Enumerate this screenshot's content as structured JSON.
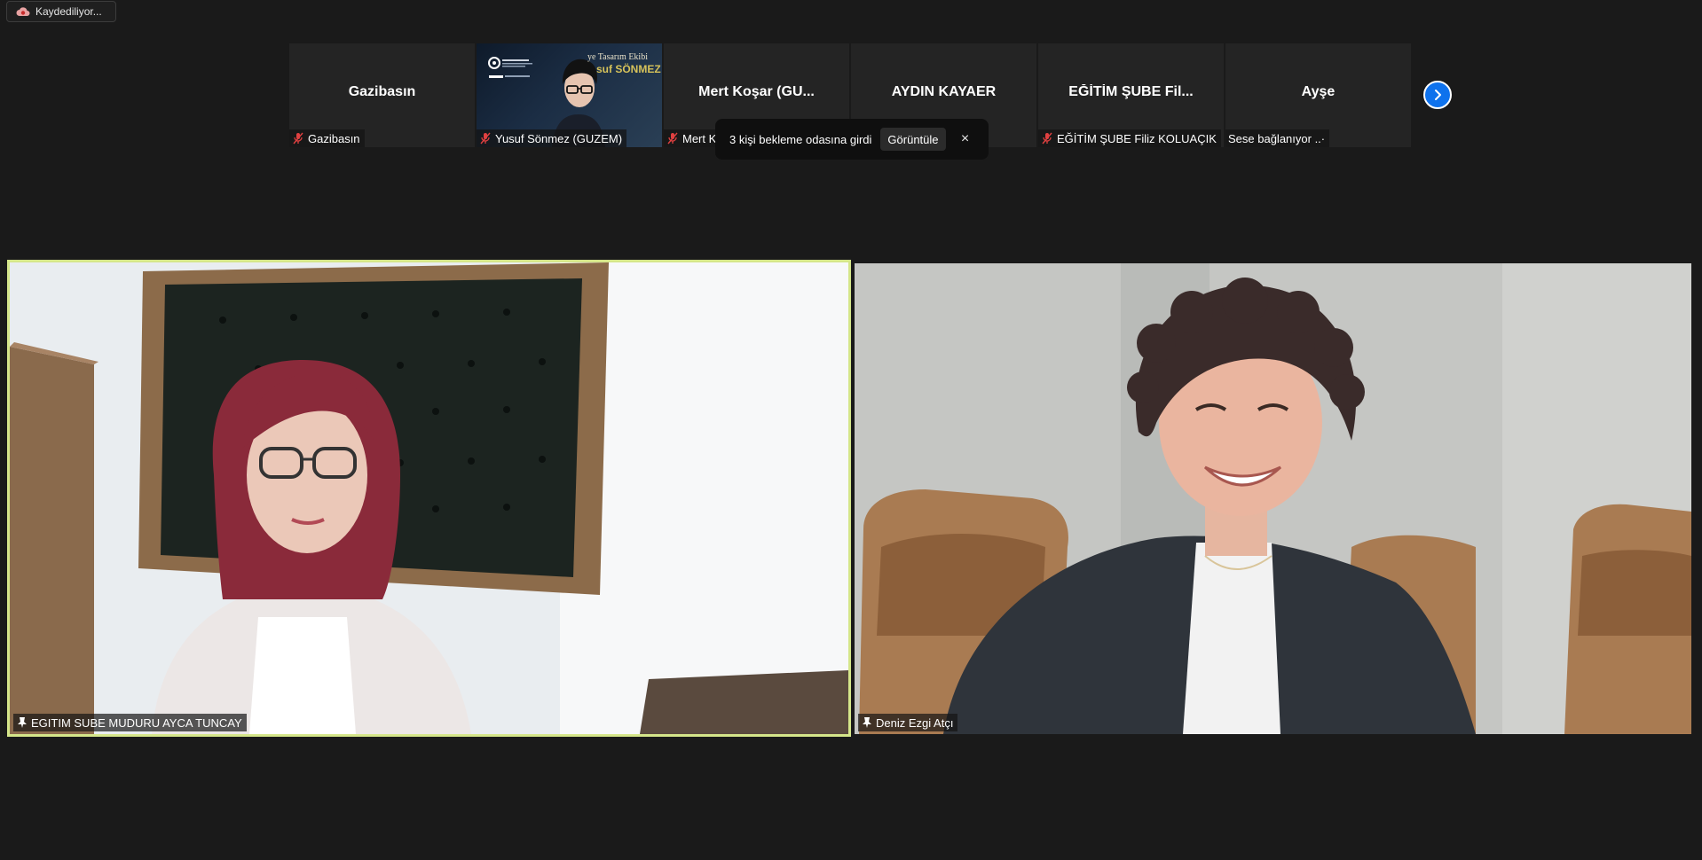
{
  "recording": {
    "label": "Kaydediliyor...",
    "icon": "cloud-record-icon"
  },
  "thumbnails": [
    {
      "name": "Gazibasın",
      "label": "Gazibasın",
      "muted": true,
      "video": false
    },
    {
      "name": "",
      "label": "Yusuf Sönmez (GUZEM)",
      "muted": true,
      "video": true,
      "overlay_line1": "ye Tasarım Ekibi",
      "overlay_line2": "suf SÖNMEZ"
    },
    {
      "name": "Mert Koşar (GU...",
      "label": "Mert K",
      "muted": true,
      "video": false
    },
    {
      "name": "AYDIN KAYAER",
      "label": "",
      "muted": false,
      "video": false
    },
    {
      "name": "EĞİTİM ŞUBE Fil...",
      "label": "EĞİTİM ŞUBE Filiz KOLUAÇIK",
      "muted": true,
      "video": false
    },
    {
      "name": "Ayşe",
      "label": "Sese bağlanıyor ..·",
      "muted": false,
      "video": false
    }
  ],
  "next_page": {
    "icon": "chevron-right-icon"
  },
  "waiting_room_toast": {
    "message": "3 kişi bekleme odasına girdi",
    "view_button": "Görüntüle",
    "close": "×"
  },
  "main_videos": {
    "left": {
      "label": "EGITIM SUBE MUDURU AYCA TUNCAY",
      "pinned": true,
      "active_speaker": true
    },
    "right": {
      "label": "Deniz Ezgi Atçı",
      "pinned": true,
      "active_speaker": false
    }
  },
  "colors": {
    "background": "#1a1a1a",
    "tile": "#242424",
    "active_speaker_border": "#d5e68a",
    "accent_blue": "#0e72ed"
  }
}
